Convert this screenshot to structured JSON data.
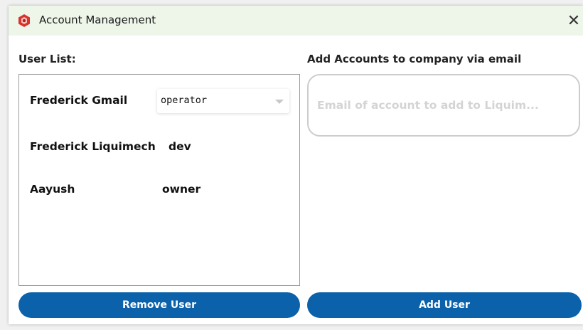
{
  "window": {
    "title": "Account Management",
    "close_glyph": "✕",
    "icon": "app-logo-icon"
  },
  "user_list": {
    "label": "User List:",
    "users": [
      {
        "name": "Frederick Gmail",
        "role": "operator",
        "role_editable": true
      },
      {
        "name": "Frederick Liquimech",
        "role": "dev"
      },
      {
        "name": "Aayush",
        "role": "owner"
      }
    ]
  },
  "add_section": {
    "label": "Add Accounts to company via email",
    "email_placeholder": "Email of account to add to Liquim..."
  },
  "buttons": {
    "remove_label": "Remove User",
    "add_label": "Add User"
  },
  "colors": {
    "titlebar_bg": "#eef6e9",
    "button_bg": "#0b61aa",
    "button_text": "#ffffff",
    "icon_red": "#d9342b"
  }
}
